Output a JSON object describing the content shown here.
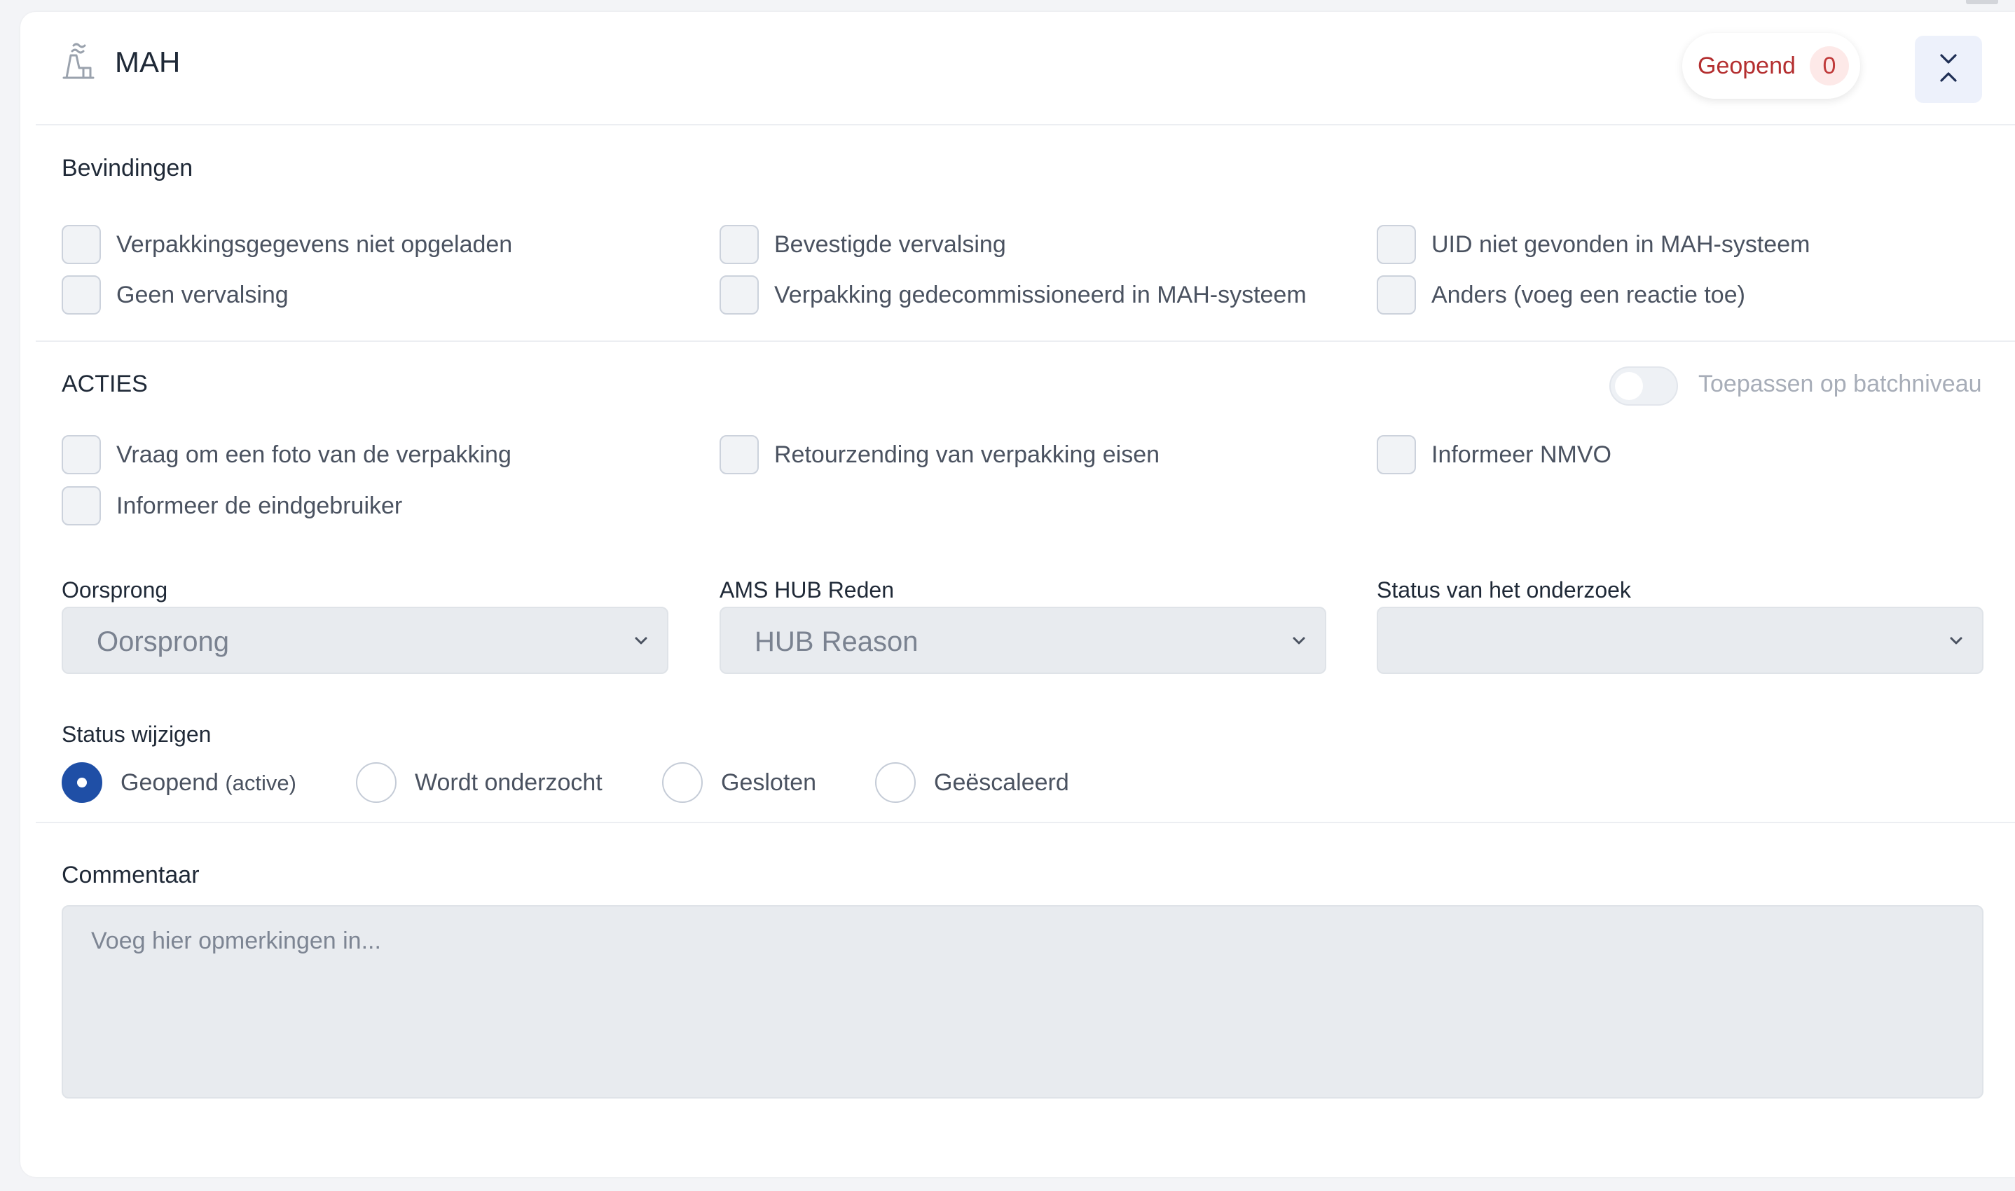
{
  "header": {
    "title": "MAH",
    "title_icon": "factory-icon",
    "status_label": "Geopend",
    "status_count": "0",
    "collapse_icon": "collapse-chevrons-icon"
  },
  "findings": {
    "title": "Bevindingen",
    "items": [
      {
        "label": "Verpakkingsgegevens niet opgeladen",
        "checked": false
      },
      {
        "label": "Bevestigde vervalsing",
        "checked": false
      },
      {
        "label": "UID niet gevonden in MAH-systeem",
        "checked": false
      },
      {
        "label": "Geen vervalsing",
        "checked": false
      },
      {
        "label": "Verpakking gedecommissioneerd in MAH-systeem",
        "checked": false
      },
      {
        "label": "Anders (voeg een reactie toe)",
        "checked": false
      }
    ]
  },
  "actions": {
    "title": "ACTIES",
    "toggle_label": "Toepassen op batchniveau",
    "toggle_on": false,
    "items": [
      {
        "label": "Vraag om een foto van de verpakking",
        "checked": false
      },
      {
        "label": "Retourzending van verpakking eisen",
        "checked": false
      },
      {
        "label": "Informeer NMVO",
        "checked": false
      },
      {
        "label": "Informeer de eindgebruiker",
        "checked": false
      }
    ]
  },
  "fields": {
    "origin": {
      "label": "Oorsprong",
      "value": "Oorsprong"
    },
    "hub_reason": {
      "label": "AMS HUB Reden",
      "value": "HUB Reason"
    },
    "investigation_status": {
      "label": "Status van het onderzoek",
      "value": ""
    }
  },
  "status_change": {
    "title": "Status wijzigen",
    "options": [
      {
        "label": "Geopend",
        "suffix": "(active)",
        "selected": true
      },
      {
        "label": "Wordt onderzocht",
        "suffix": "",
        "selected": false
      },
      {
        "label": "Gesloten",
        "suffix": "",
        "selected": false
      },
      {
        "label": "Geëscaleerd",
        "suffix": "",
        "selected": false
      }
    ]
  },
  "comment": {
    "title": "Commentaar",
    "placeholder": "Voeg hier opmerkingen in..."
  },
  "colors": {
    "accent": "#1f4fa6",
    "status_red": "#b42f30",
    "status_badge_bg": "#fde9e8"
  }
}
